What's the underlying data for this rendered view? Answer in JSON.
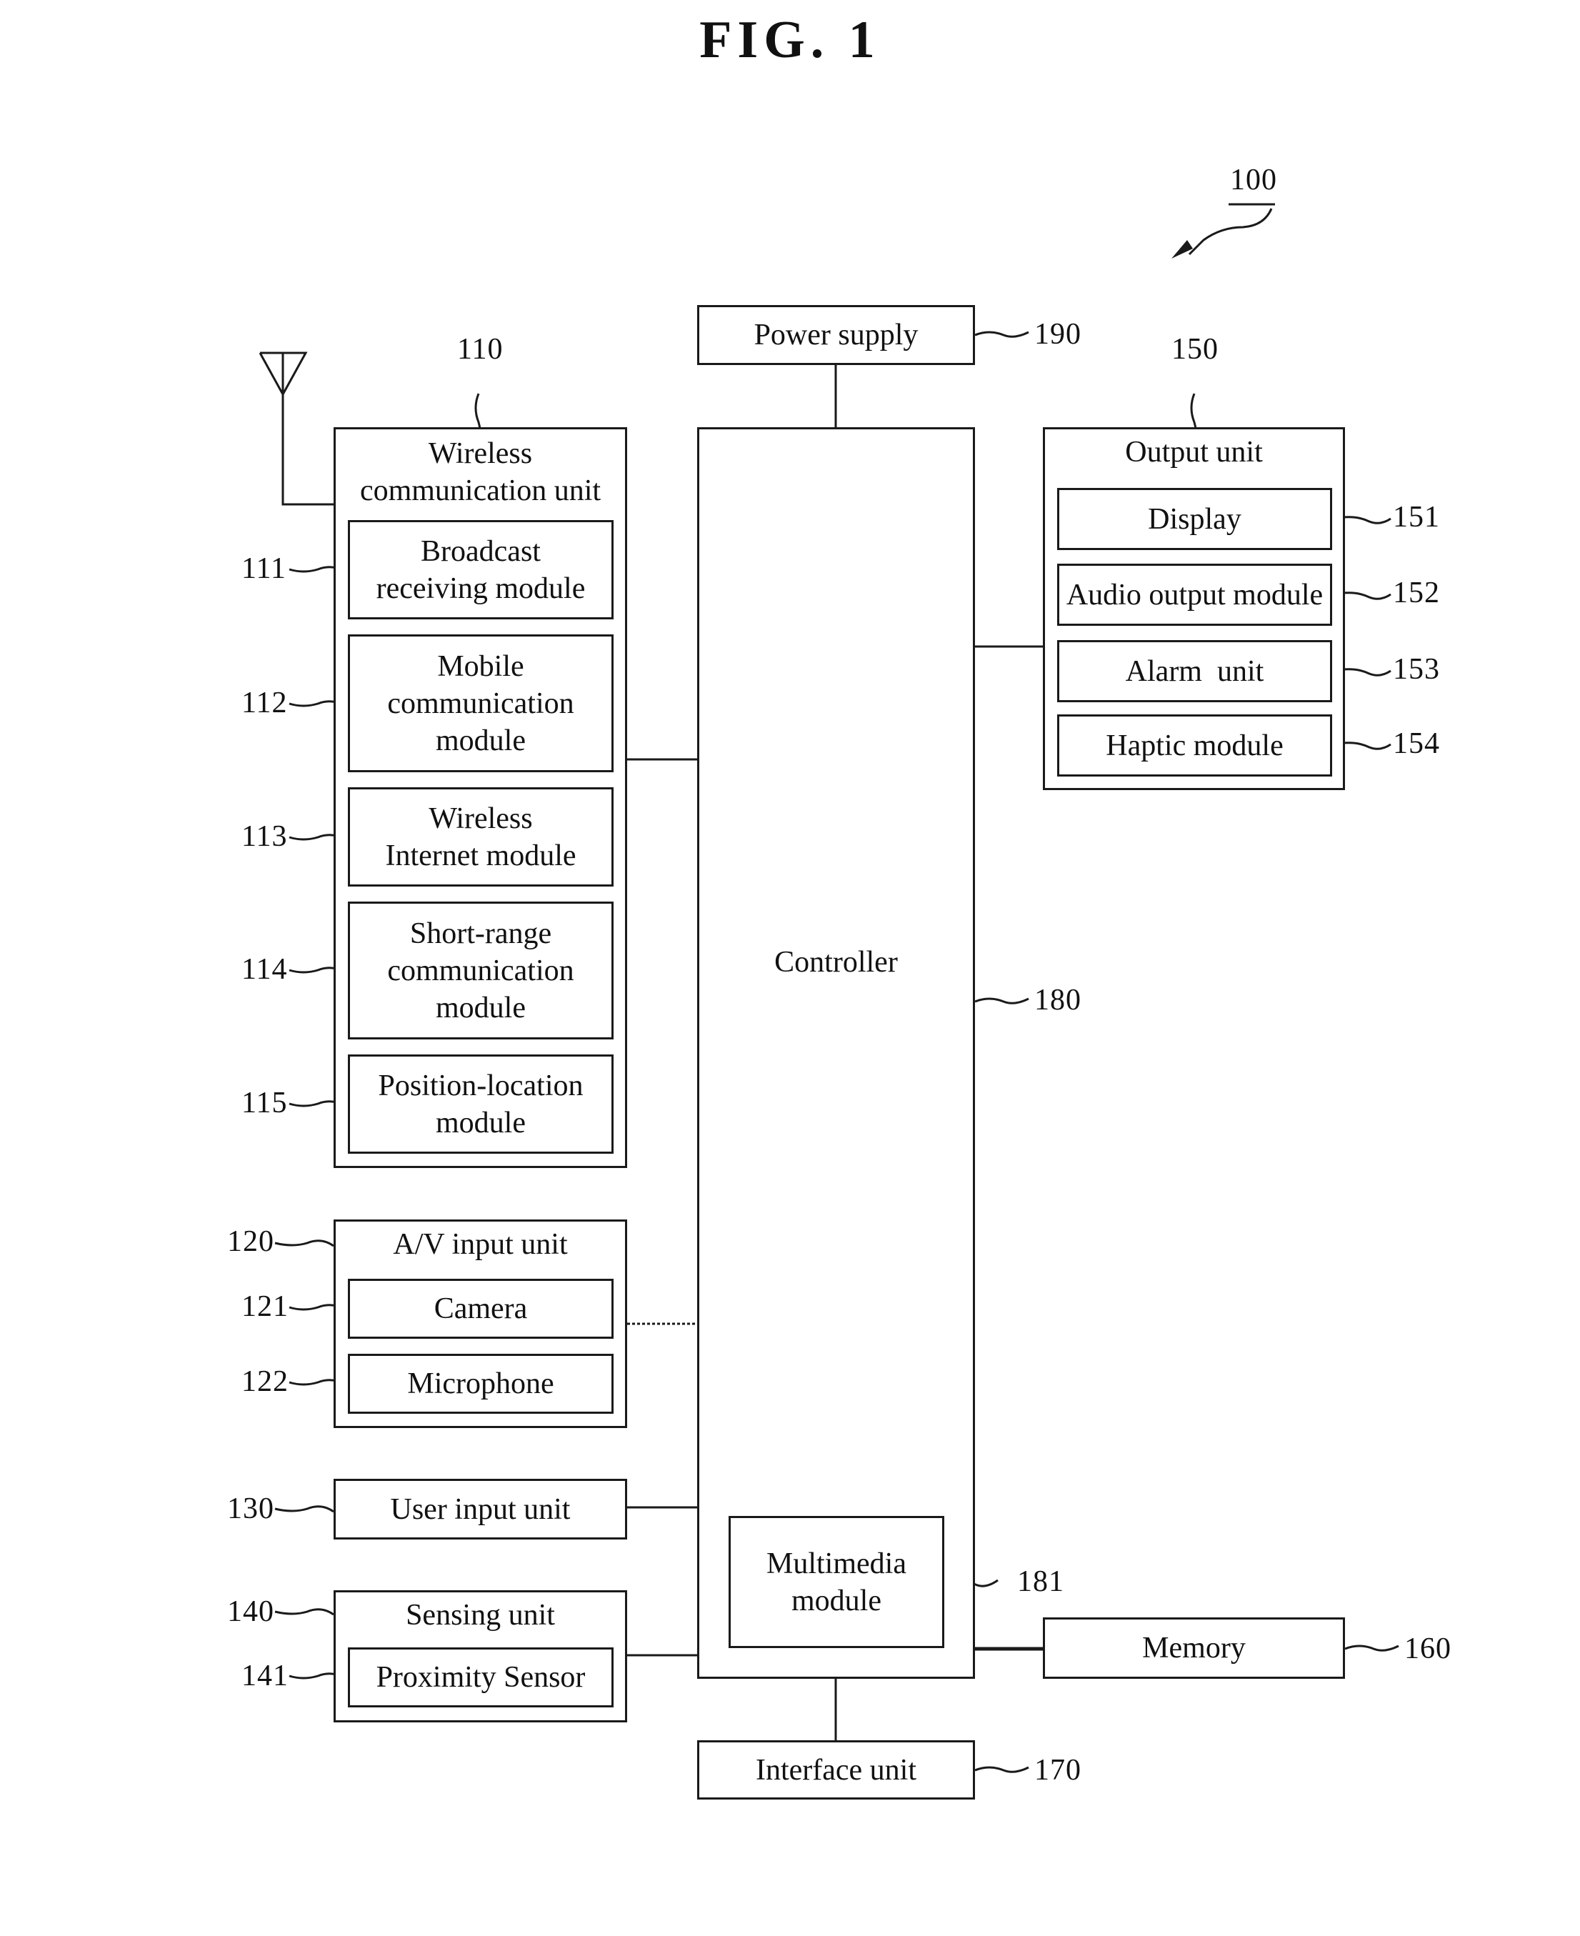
{
  "figure": {
    "title": "FIG. 1",
    "device_ref": "100"
  },
  "controller": {
    "label": "Controller",
    "ref": "180",
    "multimedia": {
      "label": "Multimedia\nmodule",
      "ref": "181"
    }
  },
  "power_supply": {
    "label": "Power supply",
    "ref": "190"
  },
  "wireless_unit": {
    "label": "Wireless\ncommunication unit",
    "ref": "110",
    "modules": [
      {
        "label": "Broadcast\nreceiving module",
        "ref": "111"
      },
      {
        "label": "Mobile\ncommunication\nmodule",
        "ref": "112"
      },
      {
        "label": "Wireless\nInternet module",
        "ref": "113"
      },
      {
        "label": "Short-range\ncommunication\nmodule",
        "ref": "114"
      },
      {
        "label": "Position-location\nmodule",
        "ref": "115"
      }
    ]
  },
  "av_input": {
    "label": "A/V input unit",
    "ref": "120",
    "modules": [
      {
        "label": "Camera",
        "ref": "121"
      },
      {
        "label": "Microphone",
        "ref": "122"
      }
    ]
  },
  "user_input": {
    "label": "User input unit",
    "ref": "130"
  },
  "sensing_unit": {
    "label": "Sensing unit",
    "ref": "140",
    "modules": [
      {
        "label": "Proximity Sensor",
        "ref": "141"
      }
    ]
  },
  "output_unit": {
    "label": "Output unit",
    "ref": "150",
    "modules": [
      {
        "label": "Display",
        "ref": "151"
      },
      {
        "label": "Audio output module",
        "ref": "152"
      },
      {
        "label": "Alarm  unit",
        "ref": "153"
      },
      {
        "label": "Haptic module",
        "ref": "154"
      }
    ]
  },
  "memory": {
    "label": "Memory",
    "ref": "160"
  },
  "interface_unit": {
    "label": "Interface unit",
    "ref": "170"
  }
}
